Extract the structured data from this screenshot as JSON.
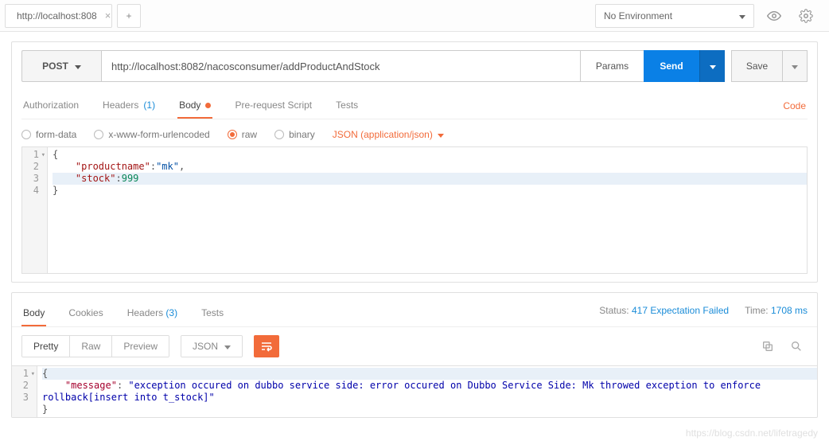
{
  "topbar": {
    "tab_title": "http://localhost:808",
    "env_label": "No Environment"
  },
  "request": {
    "method": "POST",
    "url": "http://localhost:8082/nacosconsumer/addProductAndStock",
    "params_label": "Params",
    "send_label": "Send",
    "save_label": "Save"
  },
  "reqtabs": {
    "authorization": "Authorization",
    "headers": "Headers",
    "headers_count": "(1)",
    "body": "Body",
    "prerequest": "Pre-request Script",
    "tests": "Tests",
    "code": "Code"
  },
  "body_radio": {
    "formdata": "form-data",
    "urlencoded": "x-www-form-urlencoded",
    "raw": "raw",
    "binary": "binary",
    "content_type": "JSON (application/json)"
  },
  "request_body": {
    "l1": "{",
    "l2_indent": "    ",
    "l2_key": "\"productname\"",
    "l2_sep": ":",
    "l2_val": "\"mk\"",
    "l2_end": ",",
    "l3_indent": "    ",
    "l3_key": "\"stock\"",
    "l3_sep": ":",
    "l3_val": "999",
    "l4": "}"
  },
  "gutters": {
    "g1": "1",
    "g2": "2",
    "g3": "3",
    "g4": "4"
  },
  "response": {
    "tabs": {
      "body": "Body",
      "cookies": "Cookies",
      "headers": "Headers",
      "headers_count": "(3)",
      "tests": "Tests"
    },
    "status_label": "Status:",
    "status_value": "417 Expectation Failed",
    "time_label": "Time:",
    "time_value": "1708 ms",
    "viewmodes": {
      "pretty": "Pretty",
      "raw": "Raw",
      "preview": "Preview",
      "json": "JSON"
    }
  },
  "response_body": {
    "l1": "{",
    "l2_indent": "    ",
    "l2_key": "\"message\"",
    "l2_sep": ": ",
    "l2_val": "\"exception occured on dubbo service side: error occured on Dubbo Service Side: Mk throwed exception to enforce rollback[insert into t_stock]\"",
    "l3": "}"
  },
  "resp_gutters": {
    "g1": "1",
    "g2": "2",
    "g3": "3"
  },
  "watermark": "https://blog.csdn.net/lifetragedy"
}
